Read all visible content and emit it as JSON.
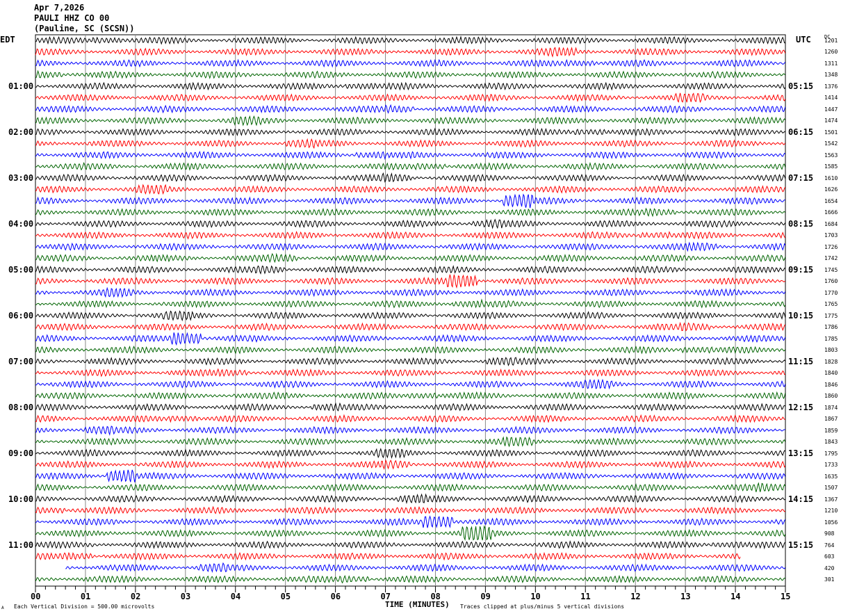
{
  "header": {
    "date": "Apr 7,2026",
    "station": "PAULI HHZ CO 00",
    "location": "(Pauline, SC (SCSN))"
  },
  "left_timezone": "EDT",
  "right_timezone": "UTC",
  "dc_header": "DC",
  "footer": {
    "scale_note": "Each Vertical Division =  500.00 microvolts",
    "clip_note": "Traces clipped at plus/minus 5 vertical divisions",
    "corner_mark": "A"
  },
  "chart_data": {
    "type": "line",
    "subtype": "helicorder",
    "xlabel": "TIME (MINUTES)",
    "xlim": [
      0,
      15
    ],
    "x_tick_labels": [
      "00",
      "01",
      "02",
      "03",
      "04",
      "05",
      "06",
      "07",
      "08",
      "09",
      "10",
      "11",
      "12",
      "13",
      "14",
      "15"
    ],
    "grid": "vertical lines every minute",
    "trace_colors": [
      "#000000",
      "#ff0000",
      "#0000ff",
      "#006400"
    ],
    "left_hour_labels": [
      "01:00",
      "02:00",
      "03:00",
      "04:00",
      "05:00",
      "06:00",
      "07:00",
      "08:00",
      "09:00",
      "10:00",
      "11:00"
    ],
    "right_hour_labels": [
      "05:15",
      "06:15",
      "07:15",
      "08:15",
      "09:15",
      "10:15",
      "11:15",
      "12:15",
      "13:15",
      "14:15",
      "15:15"
    ],
    "row_dc_values": [
      "1201",
      "1260",
      "1311",
      "1348",
      "1376",
      "1414",
      "1447",
      "1474",
      "1501",
      "1542",
      "1563",
      "1585",
      "1610",
      "1626",
      "1654",
      "1666",
      "1684",
      "1703",
      "1726",
      "1742",
      "1745",
      "1760",
      "1770",
      "1765",
      "1775",
      "1786",
      "1785",
      "1803",
      "1828",
      "1840",
      "1846",
      "1860",
      "1874",
      "1867",
      "1859",
      "1843",
      "1795",
      "1733",
      "1635",
      "1507",
      "1367",
      "1210",
      "1056",
      "908",
      "764",
      "603",
      "420",
      "301"
    ],
    "minutes_per_row": 15,
    "partial_rows": [
      {
        "row": 45,
        "end_minute": 14.1
      },
      {
        "row": 46,
        "start_minute": 0.6
      }
    ]
  }
}
